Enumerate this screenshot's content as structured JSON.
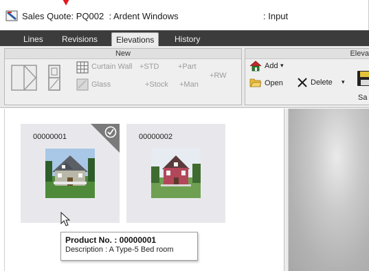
{
  "window": {
    "title": "Sales Quote: PQ002  : Ardent Windows",
    "mode": ": Input"
  },
  "tabs": [
    {
      "label": "Lines",
      "active": false
    },
    {
      "label": "Revisions",
      "active": false
    },
    {
      "label": "Elevations",
      "active": true
    },
    {
      "label": "History",
      "active": false
    }
  ],
  "ribbon": {
    "new_group": {
      "title": "New",
      "curtain_wall": "Curtain Wall",
      "glass": "Glass",
      "std": "+STD",
      "part": "+Part",
      "stock": "+Stock",
      "man": "+Man",
      "rw": "+RW"
    },
    "elevation_group": {
      "title": "Eleva",
      "add": "Add",
      "open": "Open",
      "delete": "Delete",
      "save_partial": "Sa"
    }
  },
  "elevations": [
    {
      "number": "00000001",
      "selected": true
    },
    {
      "number": "00000002",
      "selected": false
    }
  ],
  "tooltip": {
    "product_line": "Product No. : 00000001",
    "description_line": "Description : A Type-5 Bed room"
  },
  "colors": {
    "tabbar": "#3c3c3c",
    "card_bg": "#e8e8ec",
    "selected_corner": "#7a7a7a",
    "marker": "#e3191b"
  },
  "icons": [
    "app-icon",
    "door-icon",
    "window-icon",
    "curtain-wall-icon",
    "glass-icon",
    "add-house-icon",
    "open-folder-icon",
    "delete-x-icon",
    "save-icon",
    "checkmark-icon",
    "mouse-pointer-icon"
  ]
}
